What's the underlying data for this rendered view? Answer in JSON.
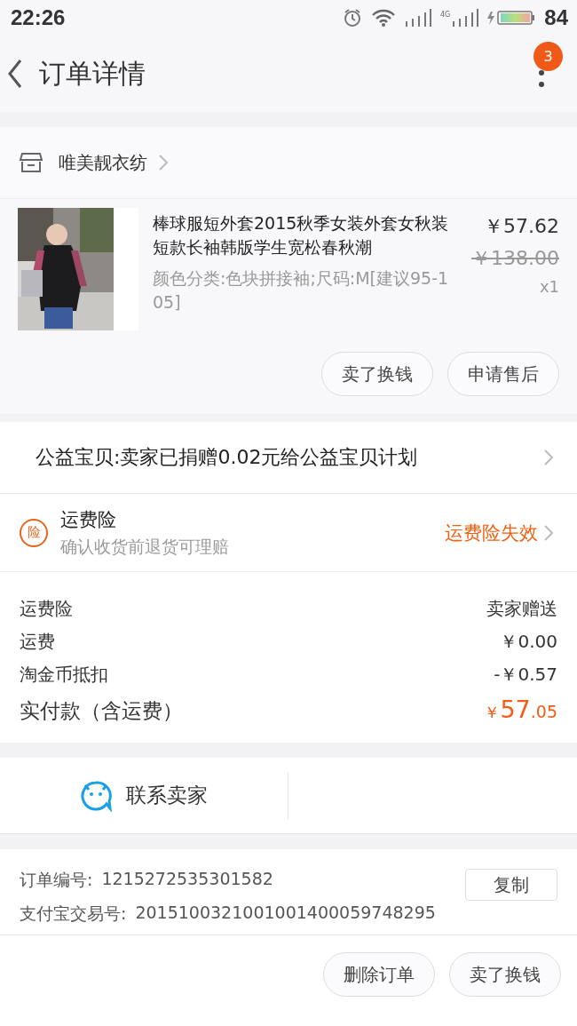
{
  "status_bar": {
    "time": "22:26",
    "network": "4G",
    "battery": "84"
  },
  "nav": {
    "title": "订单详情",
    "badge": "3"
  },
  "shop": {
    "name": "唯美靓衣纺"
  },
  "product": {
    "title": "棒球服短外套2015秋季女装外套女秋装短款长袖韩版学生宽松春秋潮",
    "spec": "颜色分类:色块拼接袖;尺码:M[建议95-105]",
    "price": "￥57.62",
    "original_price": "￥138.00",
    "quantity": "x1",
    "actions": [
      "卖了换钱",
      "申请售后"
    ]
  },
  "charity": {
    "text": "公益宝贝:卖家已捐赠0.02元给公益宝贝计划"
  },
  "insurance": {
    "icon": "险",
    "title": "运费险",
    "subtitle": "确认收货前退货可理赔",
    "status": "运费险失效"
  },
  "fees": [
    {
      "kind": "line",
      "label": "运费险",
      "value": "卖家赠送"
    },
    {
      "kind": "line",
      "label": "运费",
      "value": "￥0.00"
    },
    {
      "kind": "line",
      "label": "淘金币抵扣",
      "value": "-￥0.57"
    },
    {
      "kind": "total",
      "label": "实付款（含运费）",
      "currency": "￥",
      "integer": "57",
      "decimal": ".05"
    }
  ],
  "contact": {
    "label": "联系卖家"
  },
  "order_info": [
    {
      "label": "订单编号:",
      "value": "1215272535301582"
    },
    {
      "label": "支付宝交易号:",
      "value": "2015100321001001400059748295"
    }
  ],
  "copy_button": "复制",
  "bottom_actions": [
    "删除订单",
    "卖了换钱"
  ]
}
